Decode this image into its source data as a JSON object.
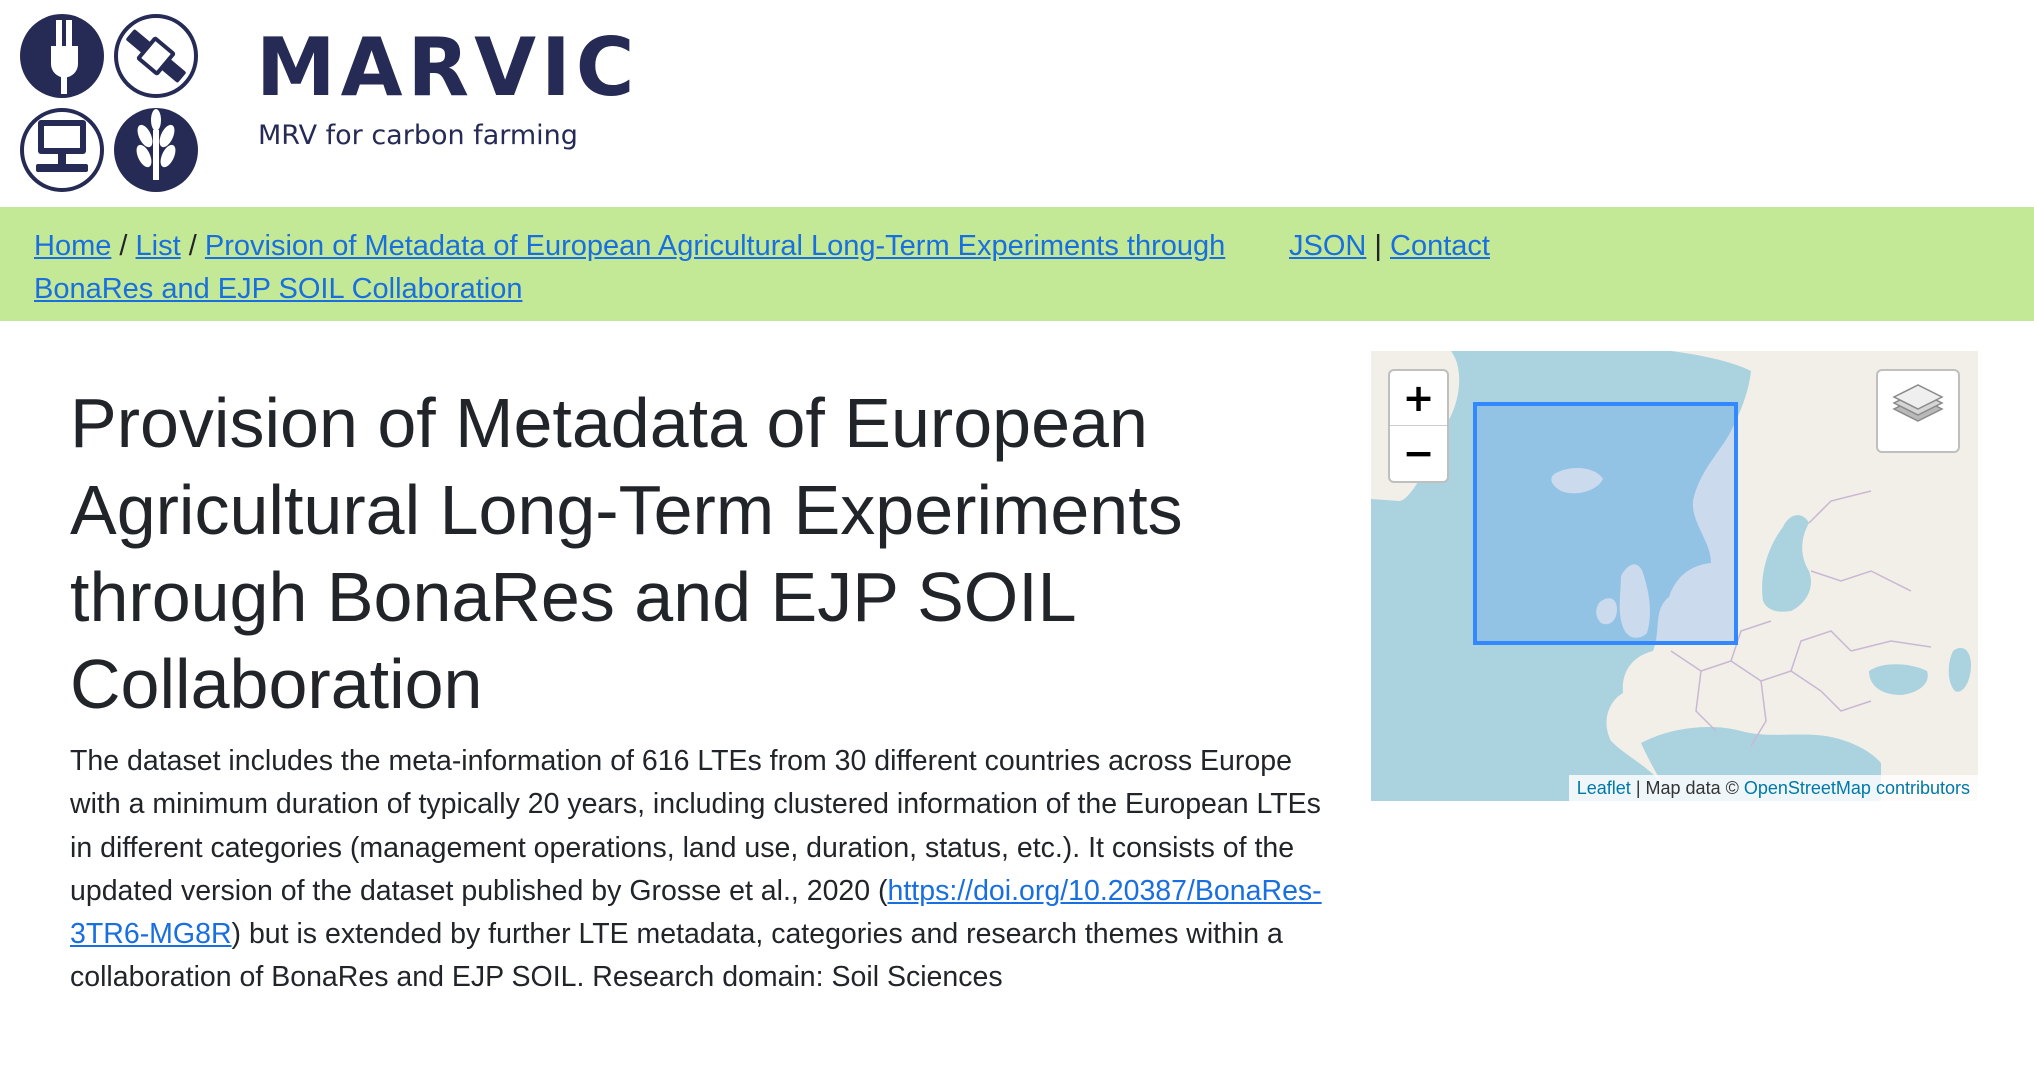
{
  "brand": {
    "title": "MARVIC",
    "subtitle": "MRV for carbon farming",
    "color": "#262b55"
  },
  "nav": {
    "background": "#c3e896",
    "breadcrumb": {
      "home": "Home",
      "list": "List",
      "current": "Provision of Metadata of European Agricultural Long-Term Experiments through BonaRes and EJP SOIL Collaboration",
      "separator": "/"
    },
    "json": "JSON",
    "divider": "|",
    "contact": "Contact"
  },
  "page": {
    "title": "Provision of Metadata of European Agricultural Long-Term Experiments through BonaRes and EJP SOIL Collaboration",
    "description_before_link": "The dataset includes the meta-information of 616 LTEs from 30 different countries across Europe with a minimum duration of typically 20 years, including clustered information of the European LTEs in different categories (management operations, land use, duration, status, etc.). It consists of the updated version of the dataset published by Grosse et al., 2020 (",
    "doi_link": "https://doi.org/10.20387/BonaRes-3TR6-MG8R",
    "description_after_link": ") but is extended by further LTE metadata, categories and research themes within a collaboration of BonaRes and EJP SOIL. Research domain: Soil Sciences"
  },
  "map": {
    "zoom_in": "+",
    "zoom_out": "−",
    "layers_icon": "layers-icon",
    "attribution": {
      "leaflet": "Leaflet",
      "separator": "|",
      "map_data": "Map data ©",
      "osm": "OpenStreetMap contributors"
    },
    "water_color": "#aad3df",
    "land_color": "#f2efe9",
    "bbox_color": "#3388ff"
  }
}
